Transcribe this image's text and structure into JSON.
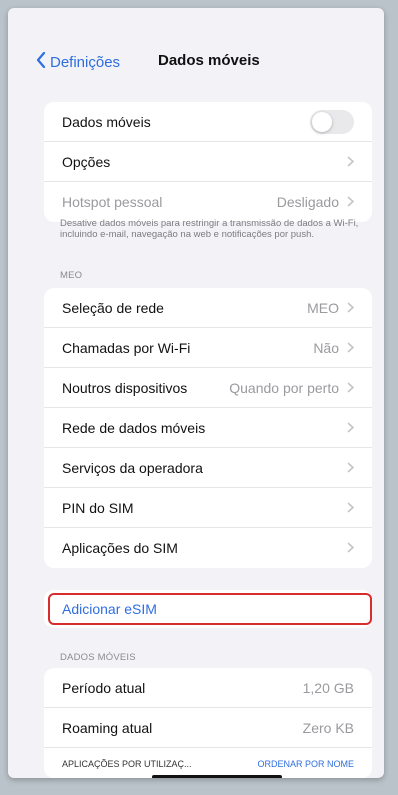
{
  "nav": {
    "back_label": "Definições",
    "title": "Dados móveis"
  },
  "group1": {
    "mobile_data_label": "Dados móveis",
    "mobile_data_on": false,
    "options_label": "Opções",
    "hotspot_label": "Hotspot pessoal",
    "hotspot_value": "Desligado"
  },
  "footnote": "Desative dados móveis para restringir a transmissão de dados a Wi-Fi, incluindo e-mail, navegação na web e notificações por push.",
  "carrier_section": {
    "header": "MEO",
    "network_selection_label": "Seleção de rede",
    "network_selection_value": "MEO",
    "wifi_calls_label": "Chamadas por Wi-Fi",
    "wifi_calls_value": "Não",
    "other_devices_label": "Noutros dispositivos",
    "other_devices_value": "Quando por perto",
    "mobile_data_network_label": "Rede de dados móveis",
    "carrier_services_label": "Serviços da operadora",
    "sim_pin_label": "PIN do SIM",
    "sim_apps_label": "Aplicações do SIM"
  },
  "esim": {
    "add_label": "Adicionar eSIM"
  },
  "usage_section": {
    "header": "DADOS MÓVEIS",
    "current_period_label": "Período atual",
    "current_period_value": "1,20 GB",
    "roaming_label": "Roaming atual",
    "roaming_value": "Zero KB",
    "apps_by_usage_label": "APLICAÇÕES POR UTILIZAÇ...",
    "sort_by_name_label": "ORDENAR POR NOME"
  },
  "colors": {
    "accent": "#2f6ee0",
    "highlight": "#d82d2d",
    "background": "#f2f2f7"
  }
}
